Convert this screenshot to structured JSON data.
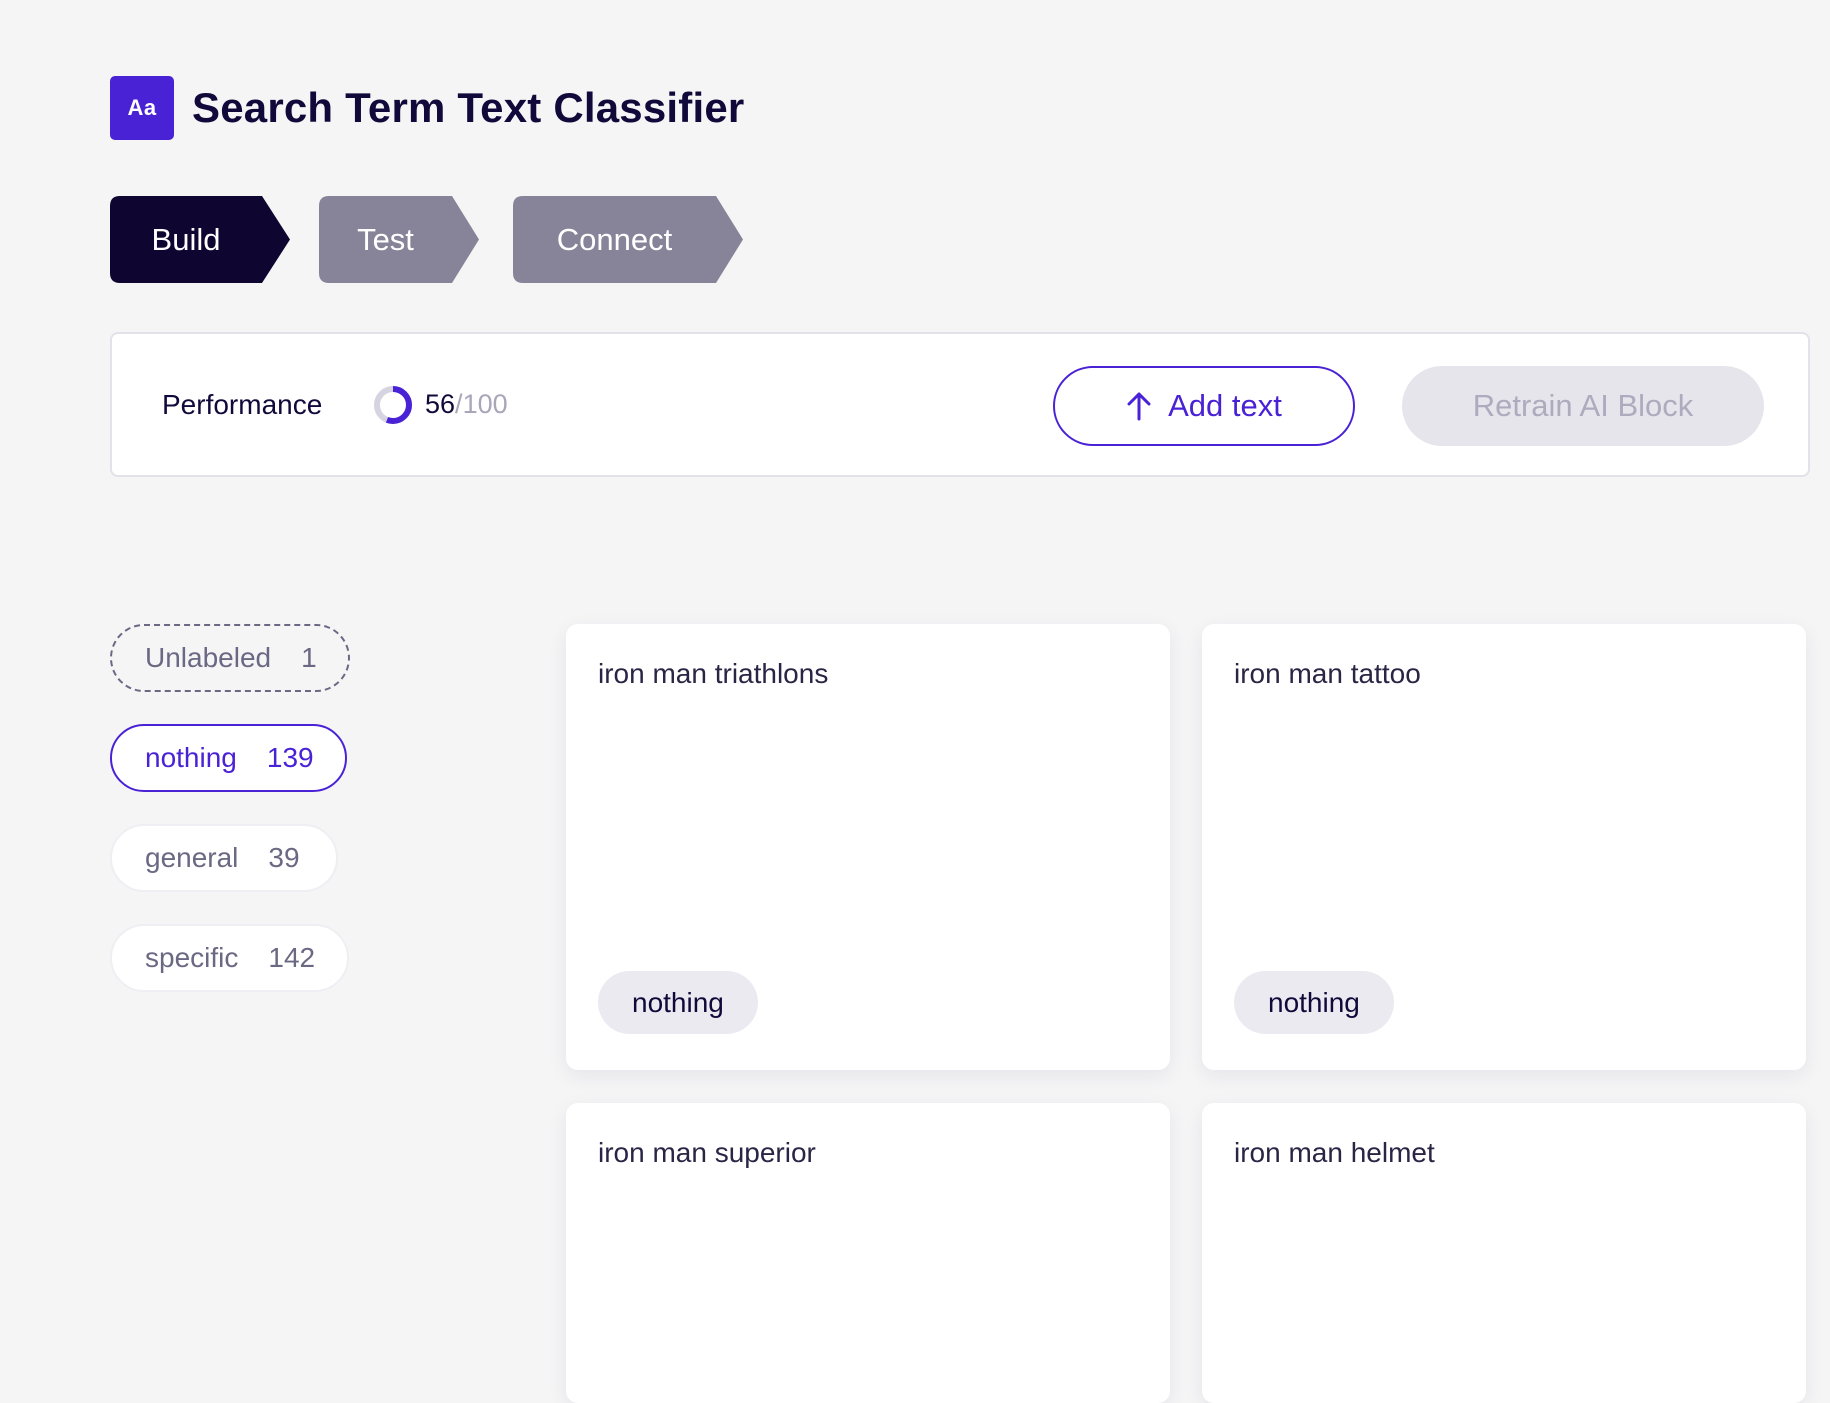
{
  "app": {
    "logo_text": "Aa",
    "title": "Search Term Text Classifier",
    "accent_color": "#4a22d6"
  },
  "steps": [
    {
      "label": "Build",
      "active": true
    },
    {
      "label": "Test",
      "active": false
    },
    {
      "label": "Connect",
      "active": false
    }
  ],
  "performance": {
    "label": "Performance",
    "score": "56",
    "separator": "/",
    "max": "100",
    "gauge_fraction": 0.56
  },
  "actions": {
    "add_text_label": "Add text",
    "add_text_icon": "arrow-up-icon",
    "retrain_label": "Retrain AI Block",
    "retrain_disabled": true
  },
  "filters": [
    {
      "label": "Unlabeled",
      "count": "1"
    },
    {
      "label": "nothing",
      "count": "139",
      "selected": true
    },
    {
      "label": "general",
      "count": "39"
    },
    {
      "label": "specific",
      "count": "142"
    }
  ],
  "cards": [
    {
      "text": "iron man triathlons",
      "label": "nothing"
    },
    {
      "text": "iron man tattoo",
      "label": "nothing"
    },
    {
      "text": "iron man superior",
      "label": ""
    },
    {
      "text": "iron man helmet",
      "label": ""
    }
  ]
}
